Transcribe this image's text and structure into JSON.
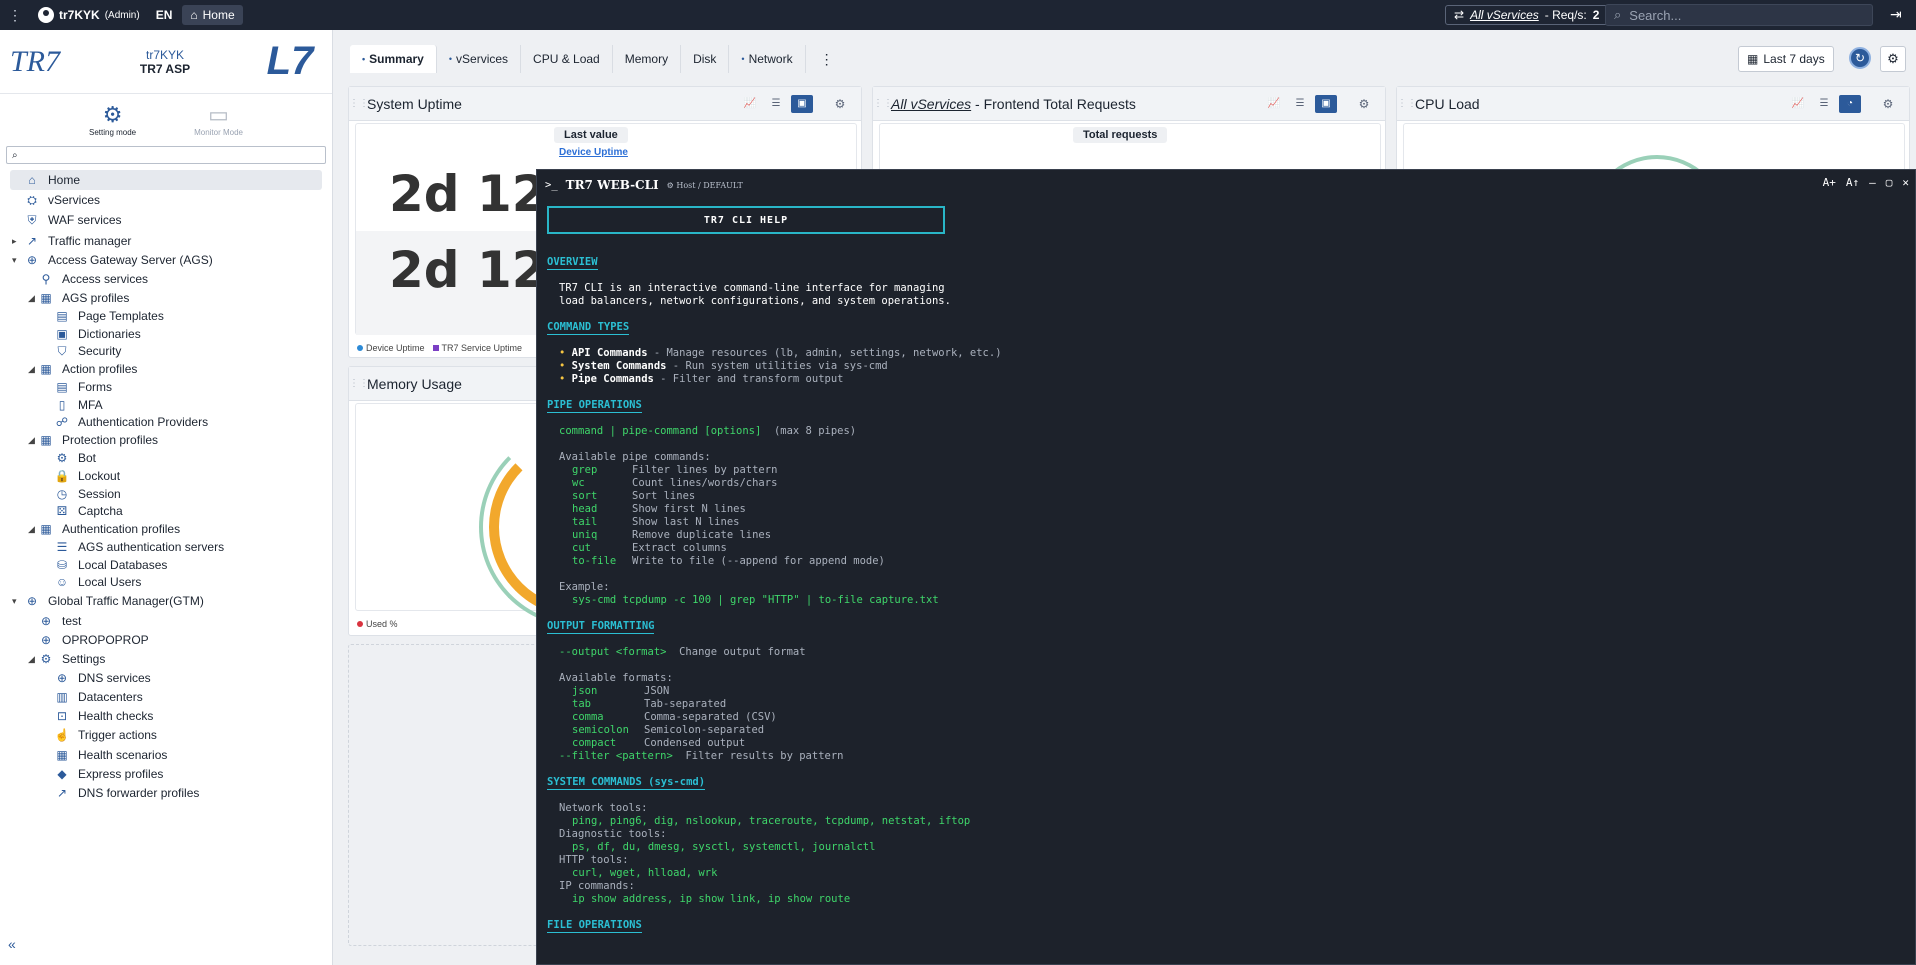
{
  "topbar": {
    "user": "tr7KYK",
    "role": "(Admin)",
    "lang": "EN",
    "home": "Home",
    "req_link": "All vServices",
    "req_label": "- Req/s:",
    "req_value": "2",
    "search_placeholder": "Search..."
  },
  "sidebar": {
    "host": "tr7KYK",
    "product": "TR7 ASP",
    "logo": "TR7",
    "modes": [
      "Setting mode",
      "Monitor Mode"
    ],
    "items": [
      {
        "label": "Home",
        "level": 0
      },
      {
        "label": "vServices",
        "level": 0
      },
      {
        "label": "WAF services",
        "level": 0
      },
      {
        "label": "Traffic manager",
        "level": 0
      },
      {
        "label": "Access Gateway Server (AGS)",
        "level": 0
      },
      {
        "label": "Access services",
        "level": 1
      },
      {
        "label": "AGS profiles",
        "level": 1
      },
      {
        "label": "Page Templates",
        "level": 2
      },
      {
        "label": "Dictionaries",
        "level": 2
      },
      {
        "label": "Security",
        "level": 2
      },
      {
        "label": "Action profiles",
        "level": 1
      },
      {
        "label": "Forms",
        "level": 2
      },
      {
        "label": "MFA",
        "level": 2
      },
      {
        "label": "Authentication Providers",
        "level": 2
      },
      {
        "label": "Protection profiles",
        "level": 1
      },
      {
        "label": "Bot",
        "level": 2
      },
      {
        "label": "Lockout",
        "level": 2
      },
      {
        "label": "Session",
        "level": 2
      },
      {
        "label": "Captcha",
        "level": 2
      },
      {
        "label": "Authentication profiles",
        "level": 1
      },
      {
        "label": "AGS authentication servers",
        "level": 2
      },
      {
        "label": "Local Databases",
        "level": 2
      },
      {
        "label": "Local Users",
        "level": 2
      },
      {
        "label": "Global Traffic Manager(GTM)",
        "level": 0
      },
      {
        "label": "test",
        "level": 1
      },
      {
        "label": "OPROPOPROP",
        "level": 1
      },
      {
        "label": "Settings",
        "level": 1
      },
      {
        "label": "DNS services",
        "level": 2
      },
      {
        "label": "Datacenters",
        "level": 2
      },
      {
        "label": "Health checks",
        "level": 2
      },
      {
        "label": "Trigger actions",
        "level": 2
      },
      {
        "label": "Health scenarios",
        "level": 2
      },
      {
        "label": "Express profiles",
        "level": 2
      },
      {
        "label": "DNS forwarder profiles",
        "level": 2
      }
    ]
  },
  "tabs": [
    "Summary",
    "vServices",
    "CPU & Load",
    "Memory",
    "Disk",
    "Network"
  ],
  "period": "Last 7 days",
  "cards": {
    "uptime": {
      "title": "System Uptime",
      "last_value": "Last value",
      "link": "Device Uptime",
      "value": "2d 12",
      "legend": [
        "Device Uptime",
        "TR7 Service Uptime"
      ]
    },
    "frontend": {
      "title_link": "All vServices",
      "title_rest": " - Frontend Total Requests",
      "label": "Total requests"
    },
    "cpu": {
      "title": "CPU Load"
    },
    "memory": {
      "title": "Memory Usage",
      "legend": "Used %"
    }
  },
  "cli": {
    "title": "TR7 WEB-CLI",
    "sub": "Host / DEFAULT",
    "help": "TR7 CLI HELP",
    "overview": "OVERVIEW",
    "ov1": "TR7 CLI is an interactive command-line interface for managing",
    "ov2": "load balancers, network configurations, and system operations.",
    "cmdtypes": "COMMAND TYPES",
    "ct1a": "API Commands",
    "ct1b": " - Manage resources (lb, admin, settings, network, etc.)",
    "ct2a": "System Commands",
    "ct2b": " - Run system utilities via sys-cmd",
    "ct3a": "Pipe Commands",
    "ct3b": " - Filter and transform output",
    "pipeops": "PIPE OPERATIONS",
    "pipe_syn": "command | pipe-command [options]",
    "pipe_max": "  (max 8 pipes)",
    "pipe_avail": "Available pipe commands:",
    "pipes": [
      {
        "c": "grep",
        "d": "Filter lines by pattern"
      },
      {
        "c": "wc",
        "d": "Count lines/words/chars"
      },
      {
        "c": "sort",
        "d": "Sort lines"
      },
      {
        "c": "head",
        "d": "Show first N lines"
      },
      {
        "c": "tail",
        "d": "Show last N lines"
      },
      {
        "c": "uniq",
        "d": "Remove duplicate lines"
      },
      {
        "c": "cut",
        "d": "Extract columns"
      },
      {
        "c": "to-file",
        "d": "Write to file (--append for append mode)"
      }
    ],
    "example": "Example:",
    "example_cmd": "sys-cmd tcpdump -c 100 | grep \"HTTP\" | to-file capture.txt",
    "outfmt": "OUTPUT FORMATTING",
    "out_opt": "--output <format>",
    "out_desc": "  Change output format",
    "fmt_avail": "Available formats:",
    "formats": [
      {
        "c": "json",
        "d": "JSON"
      },
      {
        "c": "tab",
        "d": "Tab-separated"
      },
      {
        "c": "comma",
        "d": "Comma-separated (CSV)"
      },
      {
        "c": "semicolon",
        "d": "Semicolon-separated"
      },
      {
        "c": "compact",
        "d": "Condensed output"
      }
    ],
    "filter_opt": "--filter <pattern>",
    "filter_desc": "  Filter results by pattern",
    "syscmds": "SYSTEM COMMANDS (sys-cmd)",
    "net_h": "Network tools:",
    "net_v": "ping, ping6, dig, nslookup, traceroute, tcpdump, netstat, iftop",
    "diag_h": "Diagnostic tools:",
    "diag_v": "ps, df, du, dmesg, sysctl, systemctl, journalctl",
    "http_h": "HTTP tools:",
    "http_v": "curl, wget, hlload, wrk",
    "ip_h": "IP commands:",
    "ip_v": "ip show address, ip show link, ip show route",
    "fileops": "FILE OPERATIONS"
  }
}
